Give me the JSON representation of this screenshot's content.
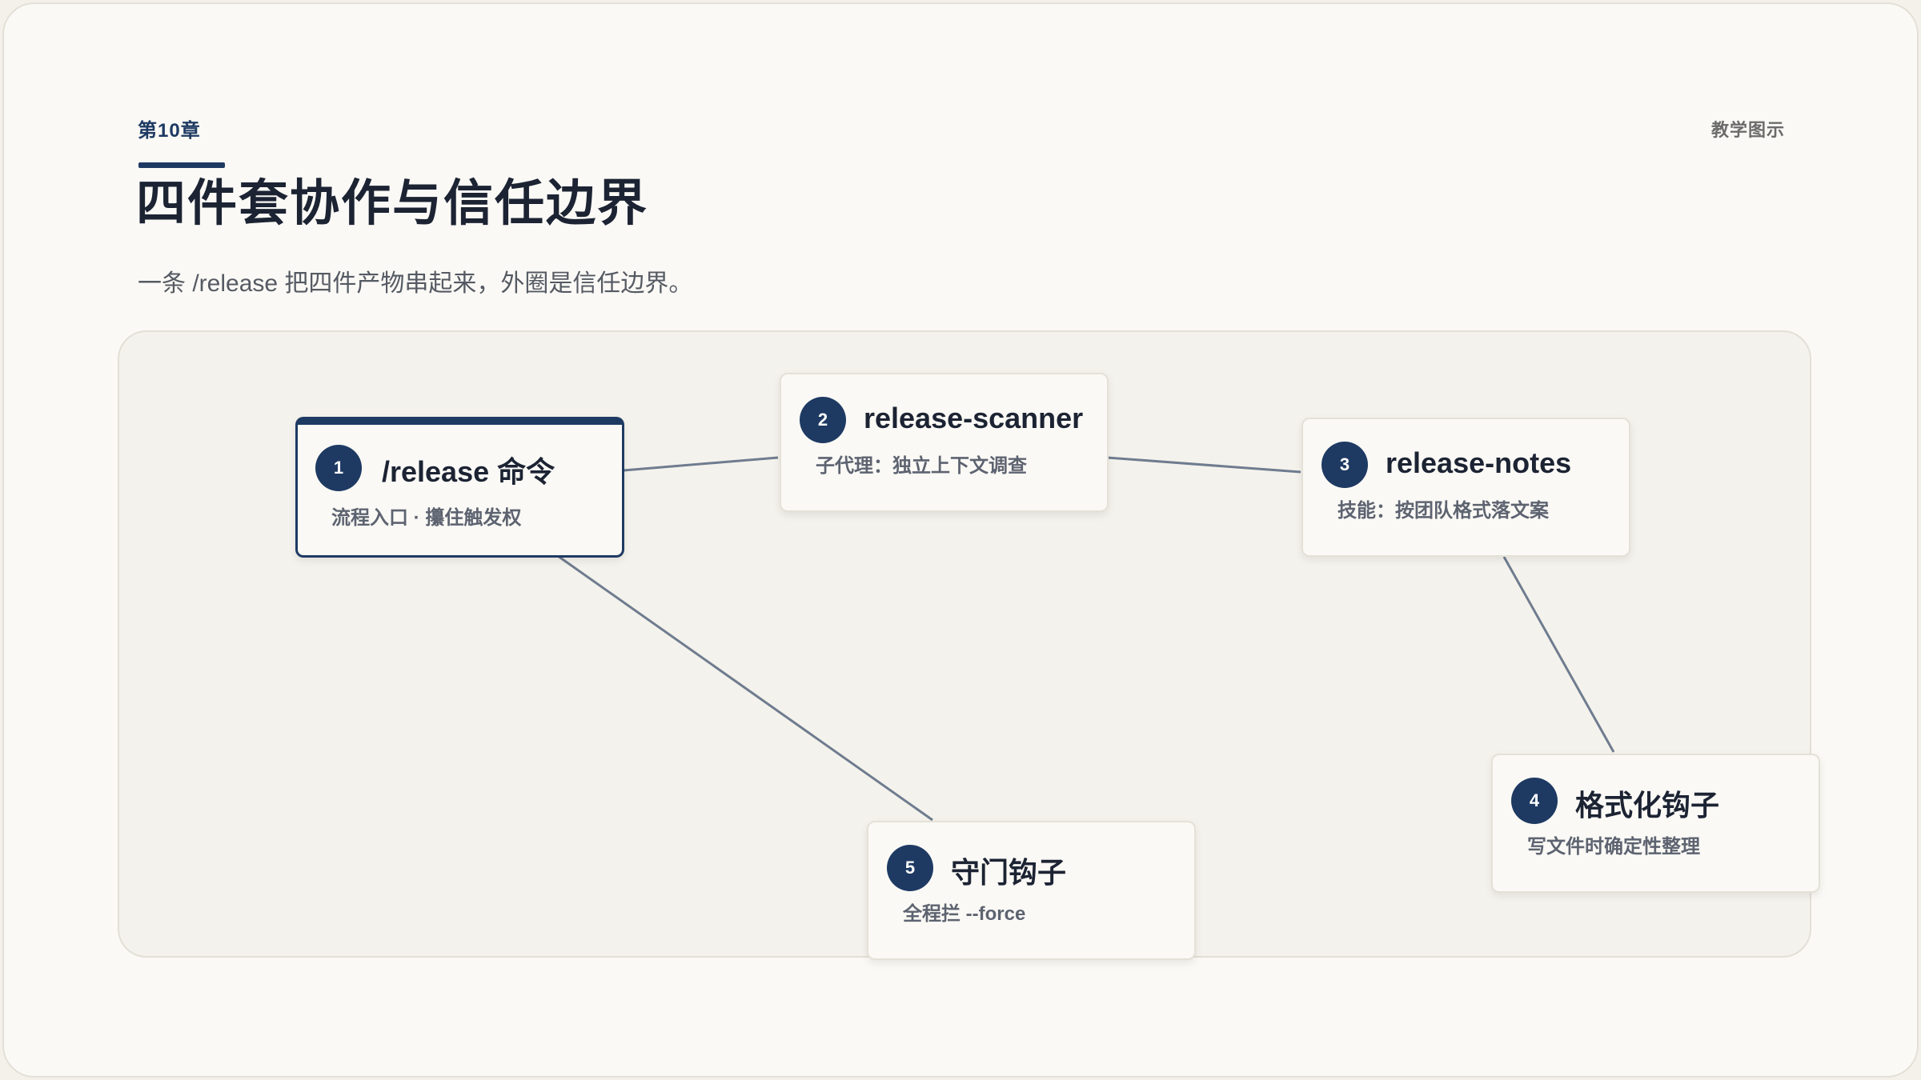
{
  "header": {
    "chapter": "第10章",
    "corner_tag": "教学图示",
    "title": "四件套协作与信任边界",
    "subtitle": "一条 /release 把四件产物串起来，外圈是信任边界。"
  },
  "nodes": [
    {
      "num": "1",
      "title": "/release 命令",
      "desc": "流程入口 · 攥住触发权"
    },
    {
      "num": "2",
      "title": "release-scanner",
      "desc": "子代理：独立上下文调查"
    },
    {
      "num": "3",
      "title": "release-notes",
      "desc": "技能：按团队格式落文案"
    },
    {
      "num": "4",
      "title": "格式化钩子",
      "desc": "写文件时确定性整理"
    },
    {
      "num": "5",
      "title": "守门钩子",
      "desc": "全程拦 --force"
    }
  ],
  "edges": [
    {
      "from": "1",
      "to": "2"
    },
    {
      "from": "2",
      "to": "3"
    },
    {
      "from": "3",
      "to": "4"
    },
    {
      "from": "1",
      "to": "5"
    }
  ],
  "colors": {
    "accent": "#1e3a63",
    "edge": "#6f7c8f",
    "card_bg": "#faf9f5",
    "stage_bg": "#f4f2ec"
  }
}
